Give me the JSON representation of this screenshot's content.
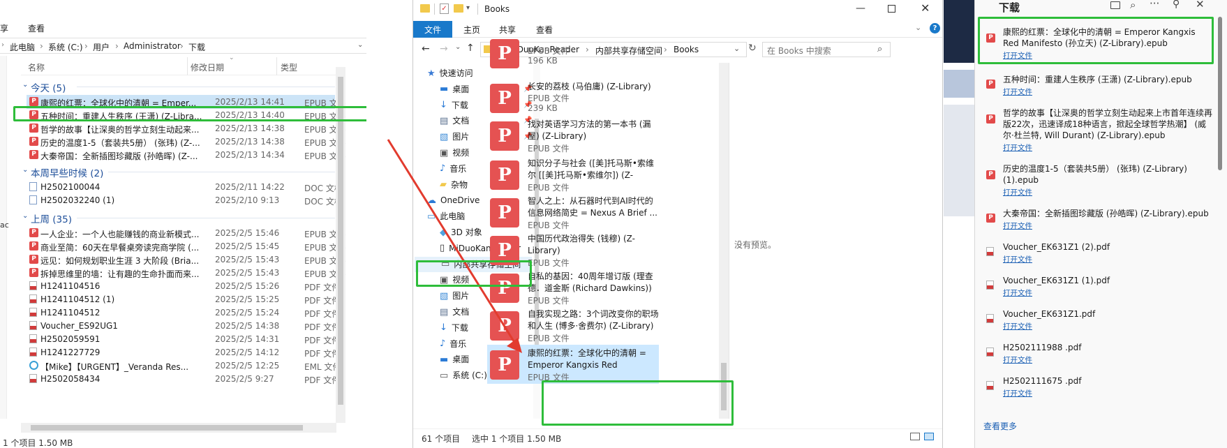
{
  "left": {
    "ribbon": [
      "享",
      "查看"
    ],
    "address": [
      "此电脑",
      "系统 (C:)",
      "用户",
      "Administrator",
      "下载"
    ],
    "columns": {
      "name": "名称",
      "date": "修改日期",
      "type": "类型"
    },
    "groups": [
      {
        "title": "今天 (5)"
      },
      {
        "title": "本周早些时候 (2)"
      },
      {
        "title": "上周 (35)"
      }
    ],
    "rows_today": [
      {
        "name": "康熙的红票：全球化中的清朝 = Emper...",
        "date": "2025/2/13 14:41",
        "type": "EPUB 文件",
        "icon": "epub-icon"
      },
      {
        "name": "五种时间：重建人生秩序 (王潇) (Z-Libra...",
        "date": "2025/2/13 14:40",
        "type": "EPUB 文件",
        "icon": "epub-icon"
      },
      {
        "name": "哲学的故事【让深奥的哲学立刻生动起来...",
        "date": "2025/2/13 14:38",
        "type": "EPUB 文件",
        "icon": "epub-icon"
      },
      {
        "name": "历史的温度1-5（套装共5册） (张玮) (Z-...",
        "date": "2025/2/13 14:38",
        "type": "EPUB 文件",
        "icon": "epub-icon"
      },
      {
        "name": "大秦帝国：全新插图珍藏版 (孙皓晖) (Z-...",
        "date": "2025/2/13 14:34",
        "type": "EPUB 文件",
        "icon": "epub-icon"
      }
    ],
    "rows_week": [
      {
        "name": "H2502100044",
        "date": "2025/2/11 14:22",
        "type": "DOC 文档",
        "icon": "doc-icon"
      },
      {
        "name": "H2502032240  (1)",
        "date": "2025/2/10 9:13",
        "type": "DOC 文档",
        "icon": "doc-icon"
      }
    ],
    "rows_last": [
      {
        "name": "一人企业：一个人也能赚钱的商业新模式...",
        "date": "2025/2/5 15:46",
        "type": "EPUB 文件",
        "icon": "epub-icon"
      },
      {
        "name": "商业至简：60天在早餐桌旁读完商学院 (...",
        "date": "2025/2/5 15:45",
        "type": "EPUB 文件",
        "icon": "epub-icon"
      },
      {
        "name": "远见：如何规划职业生涯 3 大阶段 (Bria...",
        "date": "2025/2/5 15:43",
        "type": "EPUB 文件",
        "icon": "epub-icon"
      },
      {
        "name": "拆掉思维里的墙：让有趣的生命扑面而来...",
        "date": "2025/2/5 15:43",
        "type": "EPUB 文件",
        "icon": "epub-icon"
      },
      {
        "name": "H1241104516",
        "date": "2025/2/5 15:26",
        "type": "PDF 文件",
        "icon": "pdf-icon"
      },
      {
        "name": "H1241104512  (1)",
        "date": "2025/2/5 15:25",
        "type": "PDF 文件",
        "icon": "pdf-icon"
      },
      {
        "name": "H1241104512",
        "date": "2025/2/5 15:24",
        "type": "PDF 文件",
        "icon": "pdf-icon"
      },
      {
        "name": "Voucher_ES92UG1",
        "date": "2025/2/5 14:38",
        "type": "PDF 文件",
        "icon": "pdf-icon"
      },
      {
        "name": "H2502059591",
        "date": "2025/2/5 14:31",
        "type": "PDF 文件",
        "icon": "pdf-icon"
      },
      {
        "name": "H1241227729",
        "date": "2025/2/5 14:12",
        "type": "PDF 文件",
        "icon": "pdf-icon"
      },
      {
        "name": "【Mike】【URGENT】_Veranda Res...",
        "date": "2025/2/5 12:25",
        "type": "EML 文件",
        "icon": "eml-icon"
      },
      {
        "name": "H2502058434",
        "date": "2025/2/5 9:27",
        "type": "PDF 文件",
        "icon": "pdf-icon"
      }
    ],
    "status": "1 个项目   1.50 MB"
  },
  "middle": {
    "title": "Books",
    "tabs": [
      "文件",
      "主页",
      "共享",
      "查看"
    ],
    "address": [
      "«",
      "MiDuoKanReader",
      "内部共享存储空间",
      "Books"
    ],
    "search_placeholder": "在 Books 中搜索",
    "nav": [
      {
        "label": "快速访问",
        "icon": "star-icon",
        "indent": 0
      },
      {
        "label": "桌面",
        "icon": "desktop-icon",
        "indent": 1,
        "pin": true
      },
      {
        "label": "下载",
        "icon": "download-icon",
        "indent": 1,
        "pin": true
      },
      {
        "label": "文档",
        "icon": "document-icon",
        "indent": 1,
        "pin": true
      },
      {
        "label": "图片",
        "icon": "picture-icon",
        "indent": 1,
        "pin": true
      },
      {
        "label": "视频",
        "icon": "video-icon",
        "indent": 1
      },
      {
        "label": "音乐",
        "icon": "music-icon",
        "indent": 1
      },
      {
        "label": "杂物",
        "icon": "folder-icon",
        "indent": 1
      },
      {
        "label": "OneDrive",
        "icon": "cloud-icon",
        "indent": 0
      },
      {
        "label": "此电脑",
        "icon": "pc-icon",
        "indent": 0
      },
      {
        "label": "3D 对象",
        "icon": "cube-icon",
        "indent": 1
      },
      {
        "label": "MiDuoKanReader",
        "icon": "phone-icon",
        "indent": 1
      },
      {
        "label": "内部共享存储空间",
        "icon": "drive-icon",
        "indent": 2
      },
      {
        "label": "视频",
        "icon": "video-icon",
        "indent": 1
      },
      {
        "label": "图片",
        "icon": "picture-icon",
        "indent": 1
      },
      {
        "label": "文档",
        "icon": "document-icon",
        "indent": 1
      },
      {
        "label": "下载",
        "icon": "download-icon",
        "indent": 1
      },
      {
        "label": "音乐",
        "icon": "music-icon",
        "indent": 1
      },
      {
        "label": "桌面",
        "icon": "desktop-icon",
        "indent": 1
      },
      {
        "label": "系统 (C:)",
        "icon": "drive-icon",
        "indent": 1
      }
    ],
    "tiles": [
      {
        "title": "",
        "type": "EPUB 文件",
        "size": "196 KB"
      },
      {
        "title": "长安的荔枝 (马伯庸) (Z-Library)",
        "type": "EPUB 文件",
        "size": "239 KB"
      },
      {
        "title": "找对英语学习方法的第一本书 (漏屋) (Z-Library)",
        "type": "EPUB 文件",
        "size": ""
      },
      {
        "title": "知识分子与社会 ([美]托马斯•索维尔 [[美]托马斯•索维尔]) (Z-Libra...",
        "type": "EPUB 文件",
        "size": ""
      },
      {
        "title": "智人之上：从石器时代到AI时代的信息网络简史 = Nexus A Brief ...",
        "type": "EPUB 文件",
        "size": ""
      },
      {
        "title": "中国历代政治得失 (钱穆) (Z-Library)",
        "type": "EPUB 文件",
        "size": ""
      },
      {
        "title": "自私的基因：40周年增订版 (理查德．道金斯 (Richard Dawkins)) ...",
        "type": "EPUB 文件",
        "size": ""
      },
      {
        "title": "自我实现之路：3个词改变你的职场和人生 (博多·舍费尔) (Z-Library)",
        "type": "EPUB 文件",
        "size": ""
      },
      {
        "title": "康熙的红票：全球化中的清朝 = Emperor Kangxis Red Manifes...",
        "type": "EPUB 文件",
        "size": ""
      }
    ],
    "no_preview": "没有预览。",
    "status_count": "61 个项目",
    "status_selected": "选中 1 个项目  1.50 MB"
  },
  "downloads": {
    "title": "下载",
    "items": [
      {
        "name": "康熙的红票：全球化中的清朝 = Emperor Kangxis Red Manifesto (孙立天) (Z-Library).epub",
        "open": "打开文件",
        "icon": "epub-icon"
      },
      {
        "name": "五种时间：重建人生秩序 (王潇) (Z-Library).epub",
        "open": "打开文件",
        "icon": "epub-icon"
      },
      {
        "name": "哲学的故事【让深奥的哲学立刻生动起来上市首年连续再版22次，迅速译成18种语言，掀起全球哲学热潮】 (威尔·杜兰特, Will Durant) (Z-Library).epub",
        "open": "打开文件",
        "icon": "epub-icon"
      },
      {
        "name": "历史的温度1-5（套装共5册） (张玮) (Z-Library) (1).epub",
        "open": "打开文件",
        "icon": "epub-icon"
      },
      {
        "name": "大秦帝国：全新插图珍藏版 (孙皓晖) (Z-Library).epub",
        "open": "打开文件",
        "icon": "epub-icon"
      },
      {
        "name": "Voucher_EK631Z1 (2).pdf",
        "open": "打开文件",
        "icon": "pdf-icon"
      },
      {
        "name": "Voucher_EK631Z1 (1).pdf",
        "open": "打开文件",
        "icon": "pdf-icon"
      },
      {
        "name": "Voucher_EK631Z1.pdf",
        "open": "打开文件",
        "icon": "pdf-icon"
      },
      {
        "name": "H2502111988 .pdf",
        "open": "打开文件",
        "icon": "pdf-icon"
      },
      {
        "name": "H2502111675 .pdf",
        "open": "打开文件",
        "icon": "pdf-icon"
      }
    ],
    "see_more": "查看更多"
  }
}
